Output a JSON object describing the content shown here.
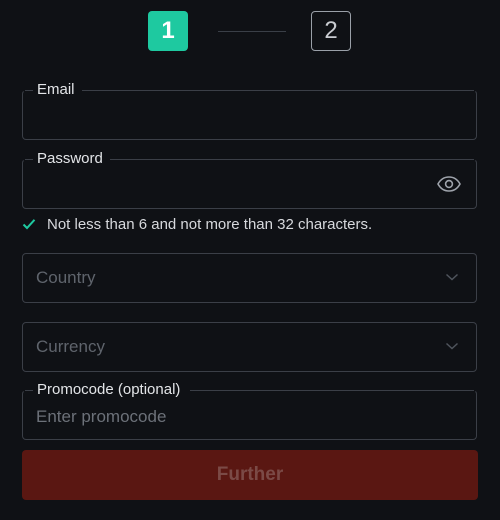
{
  "stepper": {
    "step1": "1",
    "step2": "2"
  },
  "form": {
    "email": {
      "label": "Email",
      "value": ""
    },
    "password": {
      "label": "Password",
      "value": "",
      "hint": "Not less than 6 and not more than 32 characters."
    },
    "country": {
      "placeholder": "Country"
    },
    "currency": {
      "placeholder": "Currency"
    },
    "promocode": {
      "label": "Promocode (optional)",
      "placeholder": "Enter promocode"
    },
    "submit_label": "Further"
  },
  "icons": {
    "password_toggle": "eye-icon",
    "country_dropdown": "chevron-down-icon",
    "currency_dropdown": "chevron-down-icon",
    "hint_check": "check-icon"
  },
  "colors": {
    "background": "#0f1115",
    "active_step": "#1ec9a0",
    "field_border": "#3b3f47",
    "submit_background": "#5a1712",
    "submit_text": "#7b4a46",
    "check": "#1ec9a0"
  }
}
